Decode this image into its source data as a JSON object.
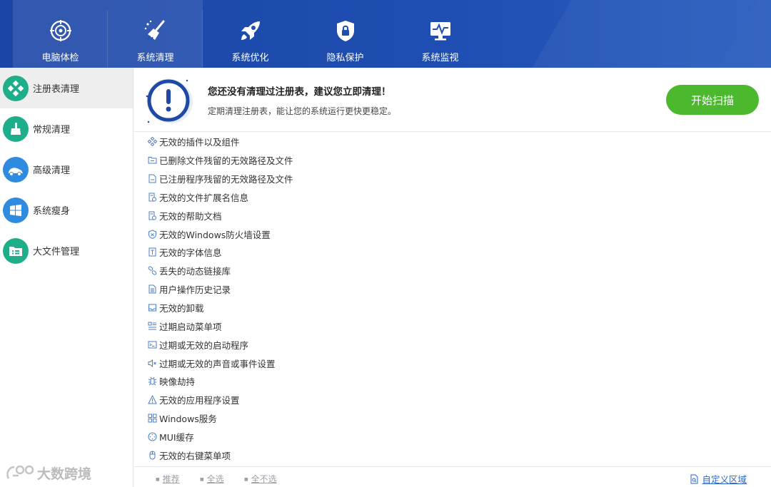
{
  "nav": [
    {
      "label": "电脑体检",
      "icon": "target-icon"
    },
    {
      "label": "系统清理",
      "icon": "broom-icon"
    },
    {
      "label": "系统优化",
      "icon": "rocket-icon"
    },
    {
      "label": "隐私保护",
      "icon": "shield-lock-icon"
    },
    {
      "label": "系统监视",
      "icon": "monitor-pulse-icon"
    }
  ],
  "sidebar": [
    {
      "label": "注册表清理",
      "icon": "registry-icon",
      "color": "#1fae8a"
    },
    {
      "label": "常规清理",
      "icon": "broom-icon",
      "color": "#1fae8a"
    },
    {
      "label": "高级清理",
      "icon": "vacuum-icon",
      "color": "#2f8be0"
    },
    {
      "label": "系统瘦身",
      "icon": "windows-icon",
      "color": "#2f8be0"
    },
    {
      "label": "大文件管理",
      "icon": "folder-icon",
      "color": "#1fae8a"
    }
  ],
  "banner": {
    "title": "您还没有清理过注册表，建议您立即清理！",
    "subtitle": "定期清理注册表，能让您的系统运行更快更稳定。",
    "scan_label": "开始扫描"
  },
  "items": [
    "无效的插件以及组件",
    "已删除文件残留的无效路径及文件",
    "已注册程序残留的无效路径及文件",
    "无效的文件扩展名信息",
    "无效的帮助文档",
    "无效的Windows防火墙设置",
    "无效的字体信息",
    "丢失的动态链接库",
    "用户操作历史记录",
    "无效的卸载",
    "过期启动菜单项",
    "过期或无效的启动程序",
    "过期或无效的声音或事件设置",
    "映像劫持",
    "无效的应用程序设置",
    "Windows服务",
    "MUI缓存",
    "无效的右键菜单项"
  ],
  "footer": {
    "recommend": "推荐",
    "select_all": "全选",
    "select_none": "全不选",
    "custom_area": "自定义区域"
  },
  "watermark": "大数跨境",
  "colors": {
    "topbar": "#1f4fb3",
    "accent_green": "#4cb82e",
    "link_blue": "#2b66c9"
  }
}
